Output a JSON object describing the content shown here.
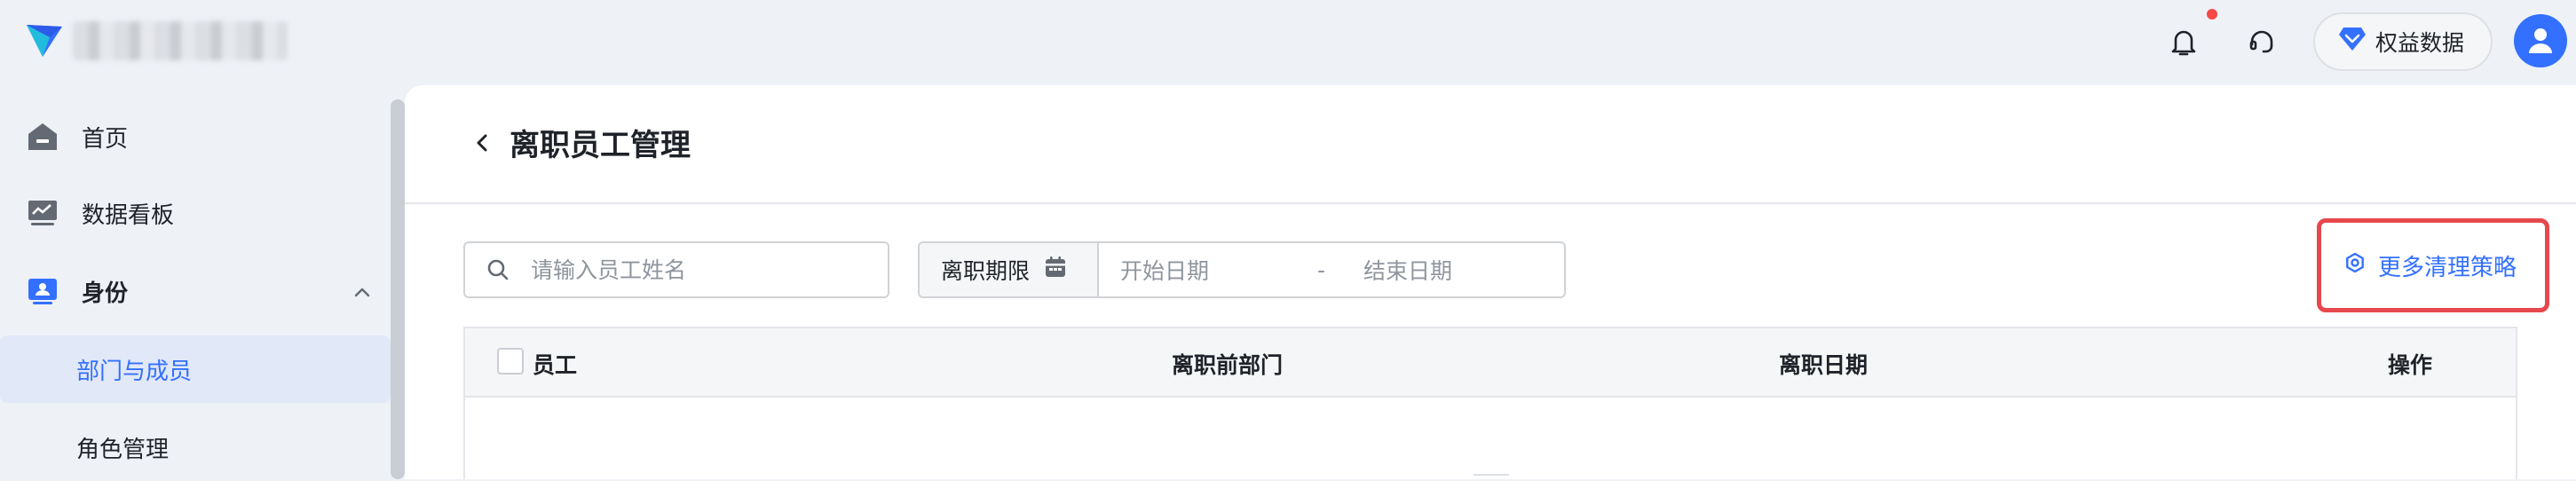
{
  "topbar": {
    "rights_label": "权益数据",
    "icons": [
      "bell-icon",
      "headset-icon",
      "diamond-icon",
      "user-icon"
    ],
    "notification_dot_color": "#f54a45"
  },
  "sidebar": {
    "items": [
      {
        "label": "首页",
        "icon": "home-icon"
      },
      {
        "label": "数据看板",
        "icon": "dashboard-icon"
      },
      {
        "label": "身份",
        "icon": "id-card-icon",
        "expanded": true
      },
      {
        "label": "部门与成员",
        "active": true
      },
      {
        "label": "角色管理"
      }
    ]
  },
  "main": {
    "title": "离职员工管理",
    "search": {
      "placeholder": "请输入员工姓名"
    },
    "date_range": {
      "label": "离职期限",
      "start_placeholder": "开始日期",
      "separator": "-",
      "end_placeholder": "结束日期"
    },
    "more_strategy": "更多清理策略",
    "table": {
      "columns": [
        "员工",
        "离职前部门",
        "离职日期",
        "操作"
      ]
    }
  },
  "colors": {
    "accent": "#3370ff",
    "highlight_border": "#e5484d",
    "active_bg": "#e1e8f7"
  }
}
